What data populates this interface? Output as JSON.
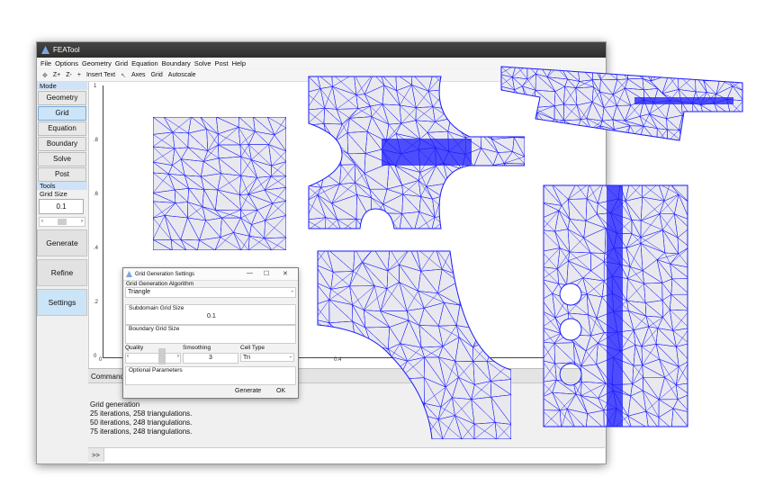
{
  "app": {
    "title": "FEATool"
  },
  "menu": [
    "File",
    "Options",
    "Geometry",
    "Grid",
    "Equation",
    "Boundary",
    "Solve",
    "Post",
    "Help"
  ],
  "toolbar": {
    "zplus": "Z+",
    "zminus": "Z-",
    "plus": "+",
    "insert_text": "Insert Text",
    "axes": "Axes",
    "grid": "Grid",
    "autoscale": "Autoscale"
  },
  "sidebar": {
    "mode_label": "Mode",
    "modes": [
      "Geometry",
      "Grid",
      "Equation",
      "Boundary",
      "Solve",
      "Post"
    ],
    "tools_label": "Tools",
    "grid_size_label": "Grid Size",
    "grid_size_value": "0.1",
    "generate": "Generate",
    "refine": "Refine",
    "settings": "Settings"
  },
  "plot": {
    "y_ticks": [
      "1",
      ".8",
      ".6",
      ".4",
      ".2",
      "0"
    ],
    "x_ticks": [
      "0",
      "0.4"
    ]
  },
  "command": {
    "label": "Command"
  },
  "console": {
    "lines": [
      "Grid generation",
      "",
      "25 iterations, 258 triangulations.",
      "50 iterations, 248 triangulations.",
      "75 iterations, 248 triangulations."
    ],
    "prompt": ">>"
  },
  "dialog": {
    "title": "Grid Generation Settings",
    "algorithm_label": "Grid Generation Algorithm",
    "algorithm_value": "Triangle",
    "subdomain_label": "Subdomain Grid Size",
    "subdomain_value": "0.1",
    "boundary_label": "Boundary Grid Size",
    "boundary_value": "",
    "quality_label": "Quality",
    "smoothing_label": "Smoothing",
    "smoothing_value": "3",
    "celltype_label": "Cell Type",
    "celltype_value": "Tri",
    "optional_label": "Optional Parameters",
    "generate": "Generate",
    "ok": "OK"
  },
  "colors": {
    "mesh": "#1a1aff",
    "fill": "#e8e8ee",
    "accent": "#cce4f7"
  }
}
